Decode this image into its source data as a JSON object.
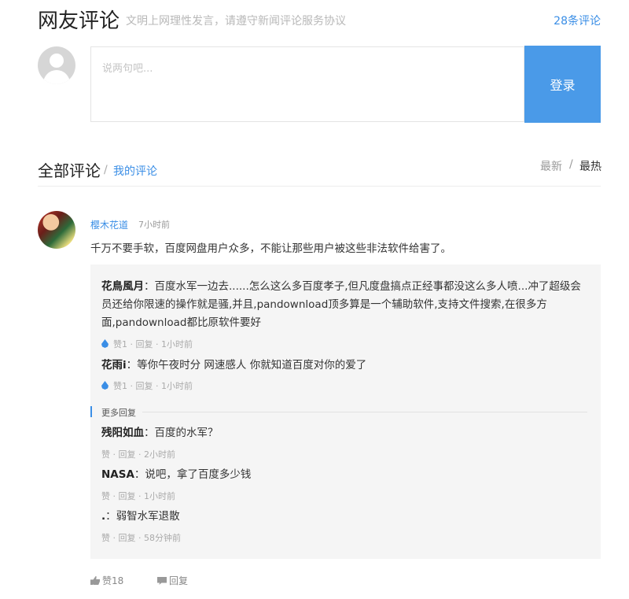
{
  "header": {
    "title": "网友评论",
    "slogan": "文明上网理性发言，请遵守新闻评论服务协议",
    "comment_count": "28条评论"
  },
  "compose": {
    "placeholder": "说两句吧...",
    "login_label": "登录"
  },
  "section": {
    "title": "全部评论",
    "separator": "/",
    "mine_label": "我的评论",
    "sort_new": "最新",
    "sort_sep": "/",
    "sort_hot": "最热"
  },
  "comment": {
    "user": "樱木花道",
    "time": "7小时前",
    "text": "千万不要手软，百度网盘用户众多，不能让那些用户被这些非法软件给害了。",
    "likes_label": "赞18",
    "reply_label": "回复"
  },
  "replies": [
    {
      "user": "花鳥風月",
      "text": "：百度水军一边去......怎么这么多百度孝子,但凡度盘搞点正经事都没这么多人喷...冲了超级会员还给你限速的操作就是骚,并且,pandownload顶多算是一个辅助软件,支持文件搜索,在很多方面,pandownload都比原软件要好",
      "meta": "赞1 · 回复 · 1小时前"
    },
    {
      "user": "花雨i",
      "text": "：等你午夜时分 网速感人 你就知道百度对你的爱了",
      "meta": "赞1 · 回复 · 1小时前"
    }
  ],
  "more_replies_label": "更多回复",
  "more_replies": [
    {
      "user": "残阳如血",
      "text": "：百度的水军？",
      "meta": "赞 · 回复 · 2小时前"
    },
    {
      "user": "NASA",
      "text": "：说吧，拿了百度多少钱",
      "meta": "赞 · 回复 · 1小时前"
    },
    {
      "user": ".",
      "text": "：弱智水军退散",
      "meta": "赞 · 回复 · 58分钟前"
    }
  ],
  "colors": {
    "accent": "#3a8ee6",
    "login_button": "#4a9ae8",
    "reply_bg": "#f5f5f5"
  },
  "icons": [
    "default-avatar-icon",
    "water-drop-icon",
    "thumb-up-icon",
    "comment-bubble-icon"
  ]
}
